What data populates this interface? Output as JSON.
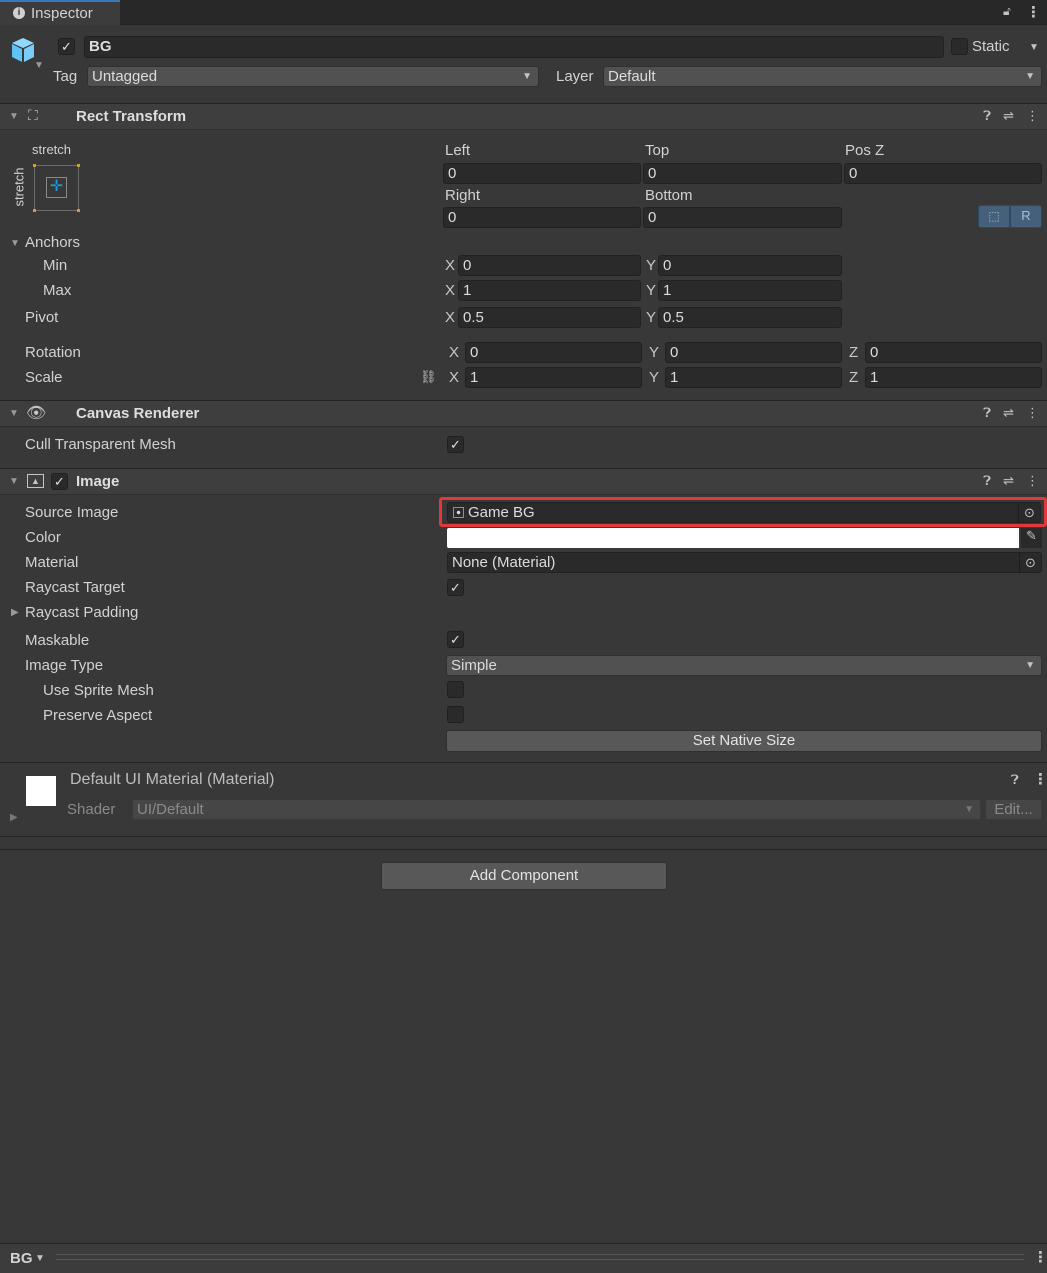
{
  "tab": {
    "title": "Inspector"
  },
  "object": {
    "name": "BG",
    "active": true,
    "static_label": "Static",
    "tag_label": "Tag",
    "tag": "Untagged",
    "layer_label": "Layer",
    "layer": "Default"
  },
  "rect_transform": {
    "title": "Rect Transform",
    "anchor_preset_h": "stretch",
    "anchor_preset_v": "stretch",
    "labels": {
      "left": "Left",
      "top": "Top",
      "posz": "Pos Z",
      "right": "Right",
      "bottom": "Bottom"
    },
    "values": {
      "left": "0",
      "top": "0",
      "posz": "0",
      "right": "0",
      "bottom": "0"
    },
    "anchors_label": "Anchors",
    "min_label": "Min",
    "max_label": "Max",
    "pivot_label": "Pivot",
    "min": {
      "x": "0",
      "y": "0"
    },
    "max": {
      "x": "1",
      "y": "1"
    },
    "pivot": {
      "x": "0.5",
      "y": "0.5"
    },
    "rotation_label": "Rotation",
    "scale_label": "Scale",
    "rotation": {
      "x": "0",
      "y": "0",
      "z": "0"
    },
    "scale": {
      "x": "1",
      "y": "1",
      "z": "1"
    },
    "axis": {
      "x": "X",
      "y": "Y",
      "z": "Z"
    },
    "raw_button": "R"
  },
  "canvas_renderer": {
    "title": "Canvas Renderer",
    "cull_label": "Cull Transparent Mesh",
    "cull": true
  },
  "image": {
    "title": "Image",
    "enabled": true,
    "source_label": "Source Image",
    "source": "Game BG",
    "color_label": "Color",
    "color": "#ffffff",
    "material_label": "Material",
    "material": "None (Material)",
    "raycast_target_label": "Raycast Target",
    "raycast_target": true,
    "raycast_padding_label": "Raycast Padding",
    "maskable_label": "Maskable",
    "maskable": true,
    "image_type_label": "Image Type",
    "image_type": "Simple",
    "use_sprite_mesh_label": "Use Sprite Mesh",
    "preserve_aspect_label": "Preserve Aspect",
    "set_native_size": "Set Native Size"
  },
  "material": {
    "title": "Default UI Material (Material)",
    "shader_label": "Shader",
    "shader": "UI/Default",
    "edit": "Edit..."
  },
  "add_component": "Add Component",
  "footer": {
    "label": "BG"
  },
  "colors": {
    "highlight": "#e0383b",
    "accent": "#2c5d87"
  }
}
